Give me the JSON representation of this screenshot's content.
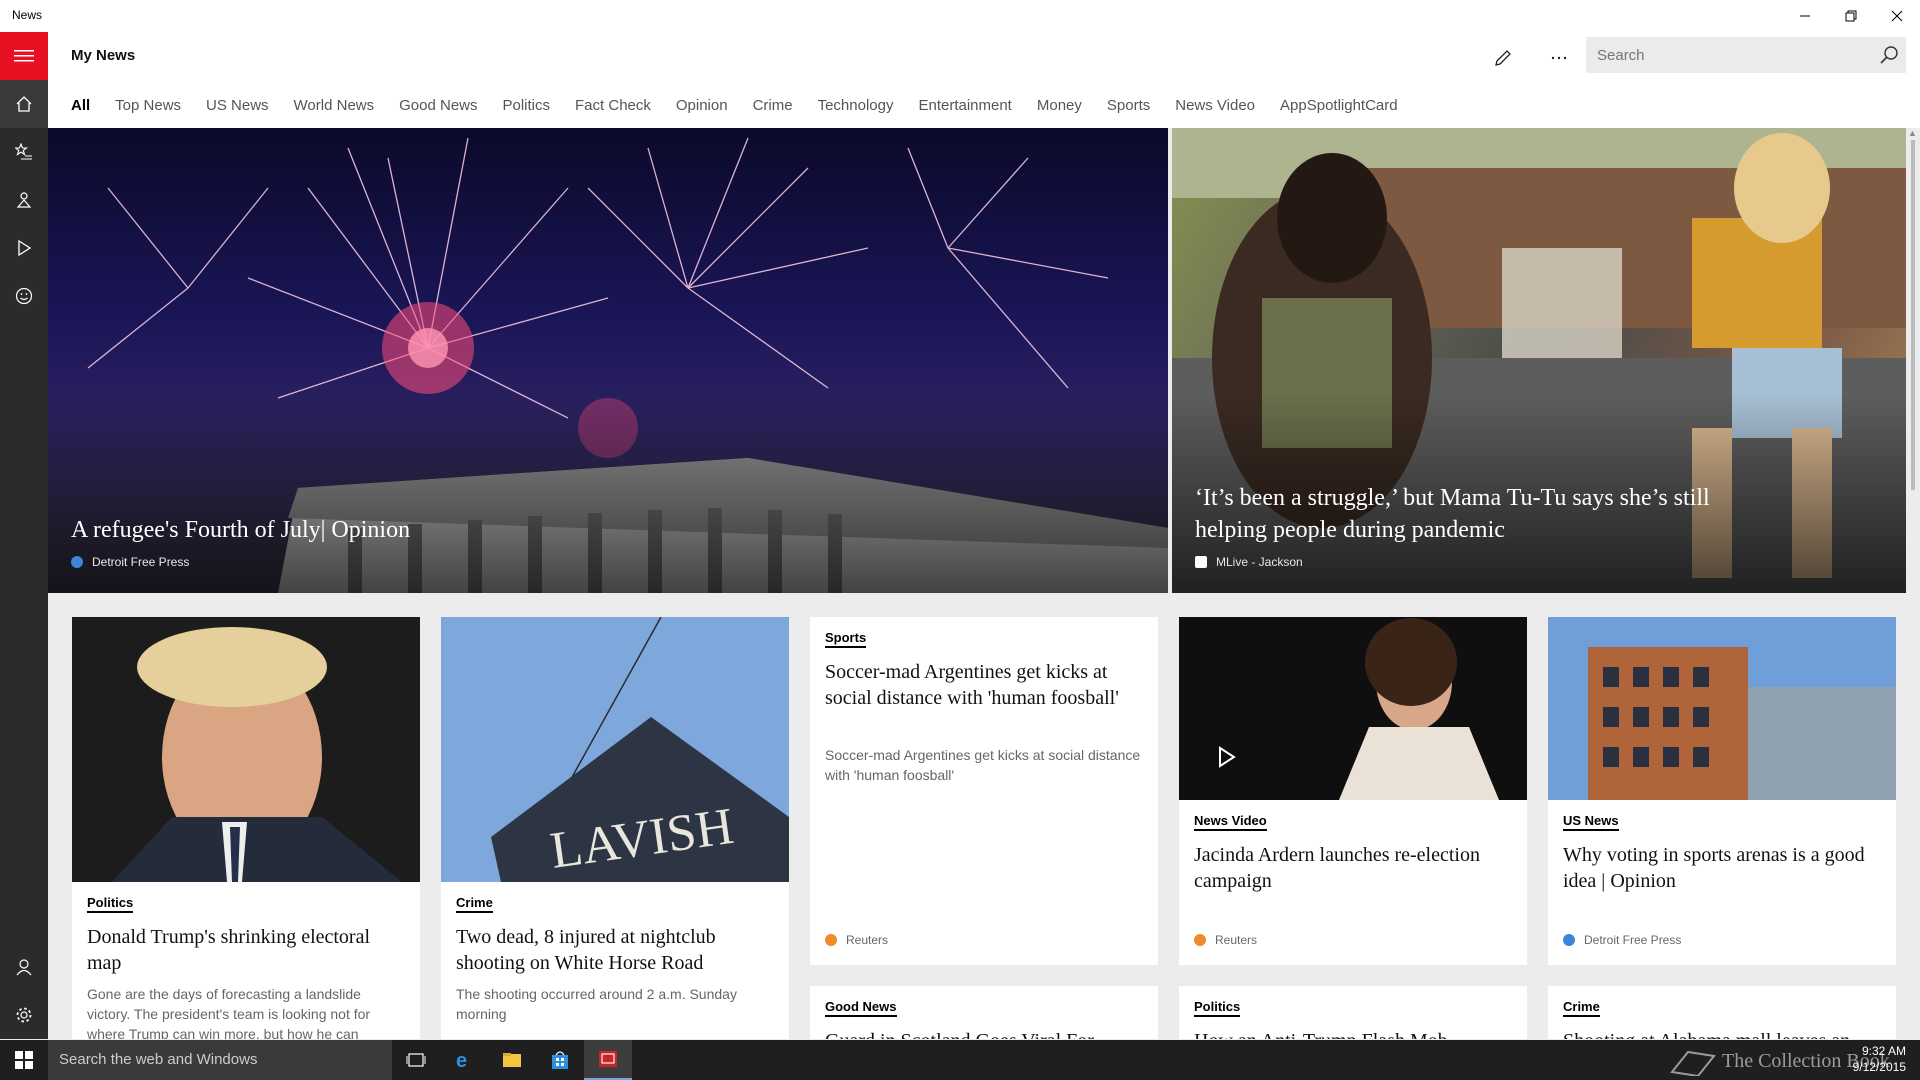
{
  "window": {
    "title": "News"
  },
  "header": {
    "title": "My News"
  },
  "search": {
    "placeholder": "Search"
  },
  "tabs": [
    {
      "label": "All",
      "active": true
    },
    {
      "label": "Top News"
    },
    {
      "label": "US News"
    },
    {
      "label": "World News"
    },
    {
      "label": "Good News"
    },
    {
      "label": "Politics"
    },
    {
      "label": "Fact Check"
    },
    {
      "label": "Opinion"
    },
    {
      "label": "Crime"
    },
    {
      "label": "Technology"
    },
    {
      "label": "Entertainment"
    },
    {
      "label": "Money"
    },
    {
      "label": "Sports"
    },
    {
      "label": "News Video"
    },
    {
      "label": "AppSpotlightCard"
    }
  ],
  "hero": [
    {
      "headline": "A refugee's Fourth of July| Opinion",
      "source": "Detroit Free Press",
      "image": "fireworks-over-building"
    },
    {
      "headline": "‘It’s been a struggle,’ but Mama Tu-Tu says she’s still helping people during pandemic",
      "source": "MLive - Jackson",
      "image": "woman-photographing-woman-on-porch"
    }
  ],
  "cards": [
    {
      "category": "Politics",
      "title": "Donald Trump's shrinking electoral map",
      "desc": "Gone are the days of forecasting a landslide victory. The president's team is looking not for where Trump can win more, but how he can",
      "image": "trump-portrait"
    },
    {
      "category": "Crime",
      "title": "Two dead, 8 injured at nightclub shooting on White Horse Road",
      "desc": "The shooting occurred around 2 a.m. Sunday morning",
      "image": "lavish-sign"
    },
    {
      "category": "Sports",
      "title": "Soccer-mad Argentines get kicks at social distance with 'human foosball'",
      "desc": "Soccer-mad Argentines get kicks at social distance with 'human foosball'",
      "source": "Reuters"
    },
    {
      "category": "News Video",
      "title": "Jacinda Ardern launches re-election campaign",
      "source": "Reuters",
      "image": "ardern-speaking"
    },
    {
      "category": "US News",
      "title": "Why voting in sports arenas is a good idea | Opinion",
      "source": "Detroit Free Press",
      "image": "arena-building"
    },
    {
      "category": "Good News",
      "title": "Guard in Scotland Goes Viral For"
    },
    {
      "category": "Politics",
      "title": "How an Anti-Trump Flash Mob"
    },
    {
      "category": "Crime",
      "title": "Shooting at Alabama mall leaves an"
    }
  ],
  "taskbar": {
    "search_placeholder": "Search the web and Windows",
    "watermark": "The Collection Book",
    "time": "9:32 AM",
    "date": "9/12/2015"
  },
  "colors": {
    "accent": "#e81123",
    "rail": "#2b2b2b",
    "taskbar": "#1f1f1f"
  }
}
